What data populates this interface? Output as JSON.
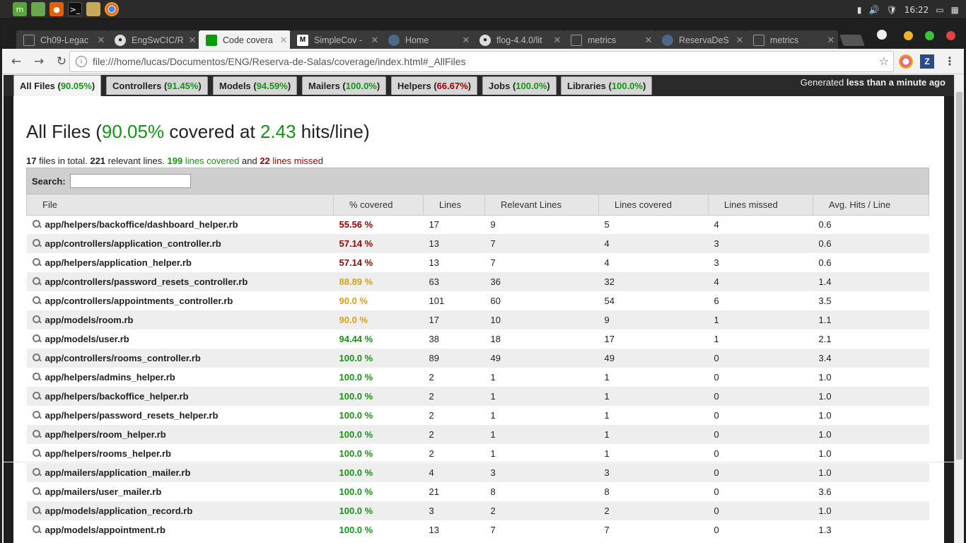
{
  "os_panel": {
    "clock": "16:22"
  },
  "browser": {
    "tabs": [
      {
        "label": "Ch09-Legac",
        "icon": "doc-icon"
      },
      {
        "label": "EngSwCIC/R",
        "icon": "github-icon"
      },
      {
        "label": "Code covera",
        "icon": "green-square-icon"
      },
      {
        "label": "SimpleCov -",
        "icon": "medium-icon"
      },
      {
        "label": "Home",
        "icon": "owl-icon"
      },
      {
        "label": "flog-4.4.0/lit",
        "icon": "github-icon"
      },
      {
        "label": "metrics",
        "icon": "doc-icon"
      },
      {
        "label": "ReservaDeS",
        "icon": "owl-icon"
      },
      {
        "label": "metrics",
        "icon": "doc-icon"
      }
    ],
    "url": "file:///home/lucas/Documentos/ENG/Reserva-de-Salas/coverage/index.html#_AllFiles"
  },
  "page": {
    "tabs": [
      {
        "name": "All Files",
        "pct": "90.05%",
        "color": "#179417"
      },
      {
        "name": "Controllers",
        "pct": "91.45%",
        "color": "#179417"
      },
      {
        "name": "Models",
        "pct": "94.59%",
        "color": "#179417"
      },
      {
        "name": "Mailers",
        "pct": "100.0%",
        "color": "#179417"
      },
      {
        "name": "Helpers",
        "pct": "66.67%",
        "color": "#990000"
      },
      {
        "name": "Jobs",
        "pct": "100.0%",
        "color": "#179417"
      },
      {
        "name": "Libraries",
        "pct": "100.0%",
        "color": "#179417"
      }
    ],
    "generated_prefix": "Generated",
    "generated_time": "less than a minute ago",
    "heading": {
      "prefix": "All Files (",
      "pct": "90.05%",
      "middle": " covered at ",
      "hits": "2.43",
      "suffix": " hits/line)"
    },
    "summary": {
      "files": "17",
      "files_text": " files in total. ",
      "relevant": "221",
      "relevant_text": " relevant lines. ",
      "covered": "199",
      "covered_text": " lines covered",
      "and_text": " and ",
      "missed": "22",
      "missed_text": " lines missed"
    },
    "search_label": "Search:",
    "columns": [
      "File",
      "% covered",
      "Lines",
      "Relevant Lines",
      "Lines covered",
      "Lines missed",
      "Avg. Hits / Line"
    ],
    "rows": [
      {
        "file": "app/helpers/backoffice/dashboard_helper.rb",
        "pct": "55.56 %",
        "level": "red",
        "lines": "17",
        "relevant": "9",
        "covered": "5",
        "missed": "4",
        "avg": "0.6"
      },
      {
        "file": "app/controllers/application_controller.rb",
        "pct": "57.14 %",
        "level": "red",
        "lines": "13",
        "relevant": "7",
        "covered": "4",
        "missed": "3",
        "avg": "0.6"
      },
      {
        "file": "app/helpers/application_helper.rb",
        "pct": "57.14 %",
        "level": "red",
        "lines": "13",
        "relevant": "7",
        "covered": "4",
        "missed": "3",
        "avg": "0.6"
      },
      {
        "file": "app/controllers/password_resets_controller.rb",
        "pct": "88.89 %",
        "level": "yellow",
        "lines": "63",
        "relevant": "36",
        "covered": "32",
        "missed": "4",
        "avg": "1.4"
      },
      {
        "file": "app/controllers/appointments_controller.rb",
        "pct": "90.0 %",
        "level": "yellow",
        "lines": "101",
        "relevant": "60",
        "covered": "54",
        "missed": "6",
        "avg": "3.5"
      },
      {
        "file": "app/models/room.rb",
        "pct": "90.0 %",
        "level": "yellow",
        "lines": "17",
        "relevant": "10",
        "covered": "9",
        "missed": "1",
        "avg": "1.1"
      },
      {
        "file": "app/models/user.rb",
        "pct": "94.44 %",
        "level": "green",
        "lines": "38",
        "relevant": "18",
        "covered": "17",
        "missed": "1",
        "avg": "2.1"
      },
      {
        "file": "app/controllers/rooms_controller.rb",
        "pct": "100.0 %",
        "level": "green",
        "lines": "89",
        "relevant": "49",
        "covered": "49",
        "missed": "0",
        "avg": "3.4"
      },
      {
        "file": "app/helpers/admins_helper.rb",
        "pct": "100.0 %",
        "level": "green",
        "lines": "2",
        "relevant": "1",
        "covered": "1",
        "missed": "0",
        "avg": "1.0"
      },
      {
        "file": "app/helpers/backoffice_helper.rb",
        "pct": "100.0 %",
        "level": "green",
        "lines": "2",
        "relevant": "1",
        "covered": "1",
        "missed": "0",
        "avg": "1.0"
      },
      {
        "file": "app/helpers/password_resets_helper.rb",
        "pct": "100.0 %",
        "level": "green",
        "lines": "2",
        "relevant": "1",
        "covered": "1",
        "missed": "0",
        "avg": "1.0"
      },
      {
        "file": "app/helpers/room_helper.rb",
        "pct": "100.0 %",
        "level": "green",
        "lines": "2",
        "relevant": "1",
        "covered": "1",
        "missed": "0",
        "avg": "1.0"
      },
      {
        "file": "app/helpers/rooms_helper.rb",
        "pct": "100.0 %",
        "level": "green",
        "lines": "2",
        "relevant": "1",
        "covered": "1",
        "missed": "0",
        "avg": "1.0"
      },
      {
        "file": "app/mailers/application_mailer.rb",
        "pct": "100.0 %",
        "level": "green",
        "lines": "4",
        "relevant": "3",
        "covered": "3",
        "missed": "0",
        "avg": "1.0"
      },
      {
        "file": "app/mailers/user_mailer.rb",
        "pct": "100.0 %",
        "level": "green",
        "lines": "21",
        "relevant": "8",
        "covered": "8",
        "missed": "0",
        "avg": "3.6"
      },
      {
        "file": "app/models/application_record.rb",
        "pct": "100.0 %",
        "level": "green",
        "lines": "3",
        "relevant": "2",
        "covered": "2",
        "missed": "0",
        "avg": "1.0"
      },
      {
        "file": "app/models/appointment.rb",
        "pct": "100.0 %",
        "level": "green",
        "lines": "13",
        "relevant": "7",
        "covered": "7",
        "missed": "0",
        "avg": "1.3"
      }
    ]
  }
}
